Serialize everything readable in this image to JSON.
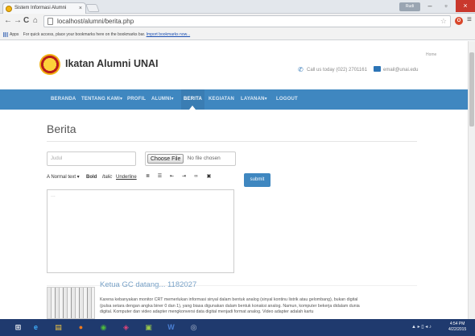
{
  "browser": {
    "tab_title": "Sistem Informasi Alumni",
    "tab_close": "×",
    "url": "localhost/alumni/berita.php",
    "bookmarks_apps": "Apps",
    "bookmarks_prompt": "For quick access, place your bookmarks here on the bookmarks bar.",
    "bookmarks_import": "Import bookmarks now...",
    "window_user": "Rudi"
  },
  "site": {
    "title": "Ikatan Alumni UNAI",
    "home_link": "Home",
    "phone_text": "Call us today (022) 2701161",
    "email_text": "email@unai.edu",
    "nav": [
      {
        "label": "BERANDA"
      },
      {
        "label": "TENTANG KAMI▾"
      },
      {
        "label": "PROFIL"
      },
      {
        "label": "ALUMNI▾"
      },
      {
        "label": "BERITA"
      },
      {
        "label": "KEGIATAN"
      },
      {
        "label": "LAYANAN▾"
      },
      {
        "label": "LOGOUT"
      }
    ]
  },
  "page": {
    "title": "Berita",
    "judul_placeholder": "Judul",
    "file_button": "Choose File",
    "file_status": "No file chosen",
    "toolbar": {
      "normal_text": "A Normal text ▾",
      "bold": "Bold",
      "italic": "Italic",
      "underline": "Underline"
    },
    "submit": "submit",
    "editor_placeholder": "..."
  },
  "post": {
    "title": "Ketua GC datang... 1182027",
    "body": "Karena kebanyakan monitor CRT memerlukan informasi sinyal dalam bentuk analog (sinyal kontinu listrik atau gelombang), bukan digital (pulsa setara dengan angka biner 0 dan 1), yang biasa digunakan dalam bentuk konaksi analog. Namun, komputer bekerja didalam dunia digital. Komputer dan video adapter mengkonversi data digital menjadi format analog. Video adapter adalah kartu"
  },
  "taskbar": {
    "time": "4:54 PM",
    "date": "4/22/2015"
  },
  "colors": {
    "nav_bg": "#3f87c0",
    "accent": "#2c74b6",
    "taskbar": "#1f3a6e"
  }
}
